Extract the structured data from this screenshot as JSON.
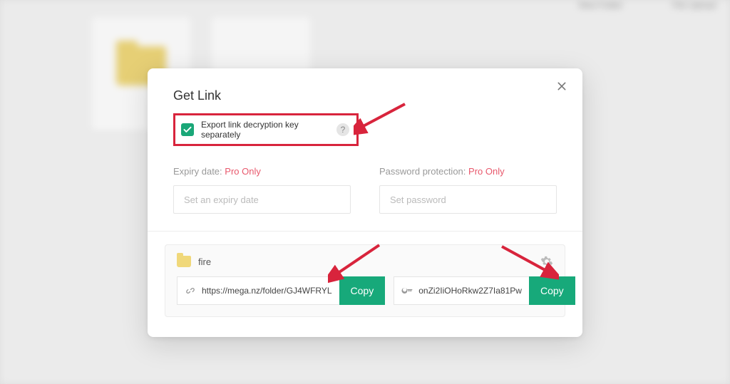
{
  "bg": {
    "button1": "New Folder",
    "button2": "File Upload"
  },
  "dialog": {
    "title": "Get Link",
    "checkbox_label": "Export link decryption key separately",
    "help_symbol": "?",
    "expiry": {
      "label": "Expiry date:",
      "pro": "Pro Only",
      "placeholder": "Set an expiry date"
    },
    "password": {
      "label": "Password protection:",
      "pro": "Pro Only",
      "placeholder": "Set password"
    },
    "item_name": "fire",
    "link_value": "https://mega.nz/folder/GJ4WFRYL",
    "key_value": "onZi2IiOHoRkw2Z7Ia81Pw",
    "copy_label": "Copy"
  }
}
